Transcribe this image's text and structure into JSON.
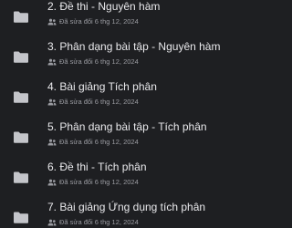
{
  "folders": [
    {
      "title": "2. Đề thi - Nguyên hàm",
      "meta": "Đã sửa đổi 6 thg 12, 2024"
    },
    {
      "title": "3. Phân dạng bài tập - Nguyên hàm",
      "meta": "Đã sửa đổi 6 thg 12, 2024"
    },
    {
      "title": "4. Bài giảng Tích phân",
      "meta": "Đã sửa đổi 6 thg 12, 2024"
    },
    {
      "title": "5. Phân dạng bài tập - Tích phân",
      "meta": "Đã sửa đổi 6 thg 12, 2024"
    },
    {
      "title": "6. Đề thi - Tích phân",
      "meta": "Đã sửa đổi 6 thg 12, 2024"
    },
    {
      "title": "7. Bài giảng Ứng dụng tích phân",
      "meta": "Đã sửa đổi 6 thg 12, 2024"
    }
  ],
  "icons": {
    "folder": "folder-icon",
    "shared": "shared-people-icon"
  },
  "colors": {
    "background": "#1e1f22",
    "folder": "#c4c5ca",
    "title": "#e9e9ec",
    "meta": "#9b9ca2"
  }
}
